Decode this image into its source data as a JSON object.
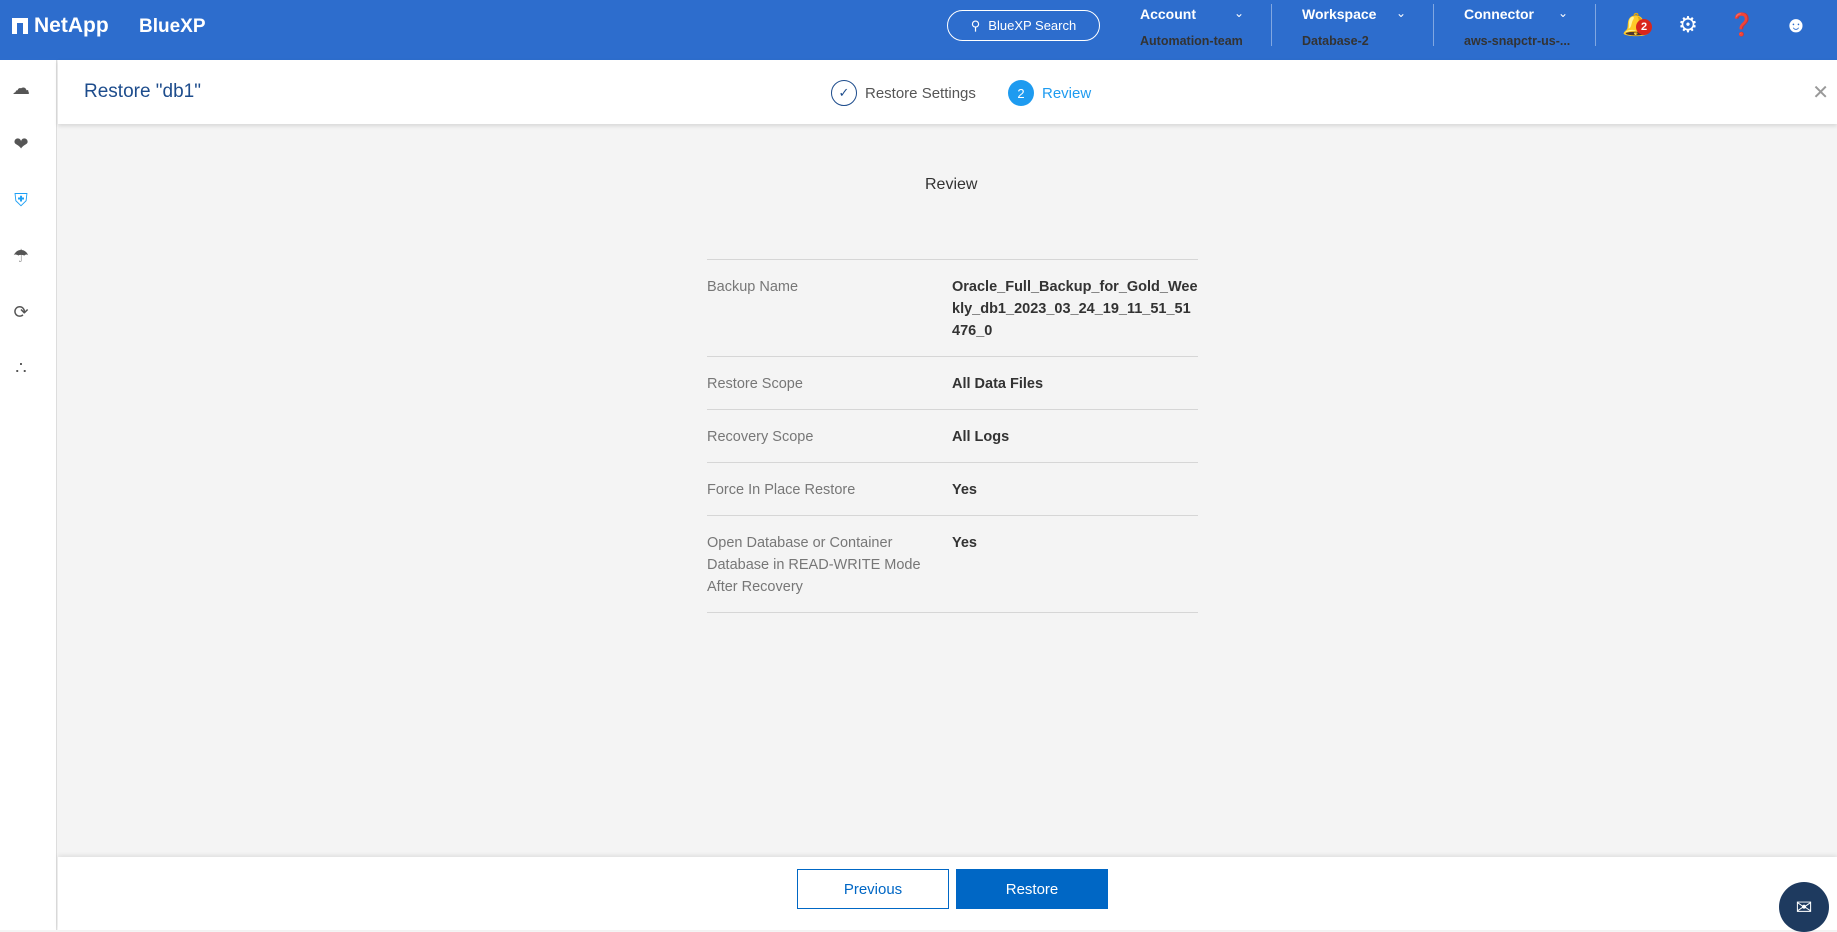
{
  "topbar": {
    "brand": "NetApp",
    "product": "BlueXP",
    "search_label": "BlueXP Search",
    "account": {
      "label": "Account",
      "value": "Automation-team"
    },
    "workspace": {
      "label": "Workspace",
      "value": "Database-2"
    },
    "connector": {
      "label": "Connector",
      "value": "aws-snapctr-us-..."
    },
    "notification_count": "2"
  },
  "header": {
    "title": "Restore \"db1\"",
    "steps": [
      {
        "label": "Restore Settings",
        "state": "done"
      },
      {
        "number": "2",
        "label": "Review",
        "state": "active"
      }
    ]
  },
  "review": {
    "heading": "Review",
    "rows": [
      {
        "key": "Backup Name",
        "value": "Oracle_Full_Backup_for_Gold_Weekly_db1_2023_03_24_19_11_51_51476_0"
      },
      {
        "key": "Restore Scope",
        "value": "All Data Files"
      },
      {
        "key": "Recovery Scope",
        "value": "All Logs"
      },
      {
        "key": "Force In Place Restore",
        "value": "Yes"
      },
      {
        "key": "Open Database or Container Database in READ-WRITE Mode After Recovery",
        "value": "Yes"
      }
    ]
  },
  "footer": {
    "previous": "Previous",
    "restore": "Restore"
  },
  "colors": {
    "brand": "#2d6dcd",
    "primary_button": "#0067c5",
    "active_step": "#1e9bf0"
  }
}
